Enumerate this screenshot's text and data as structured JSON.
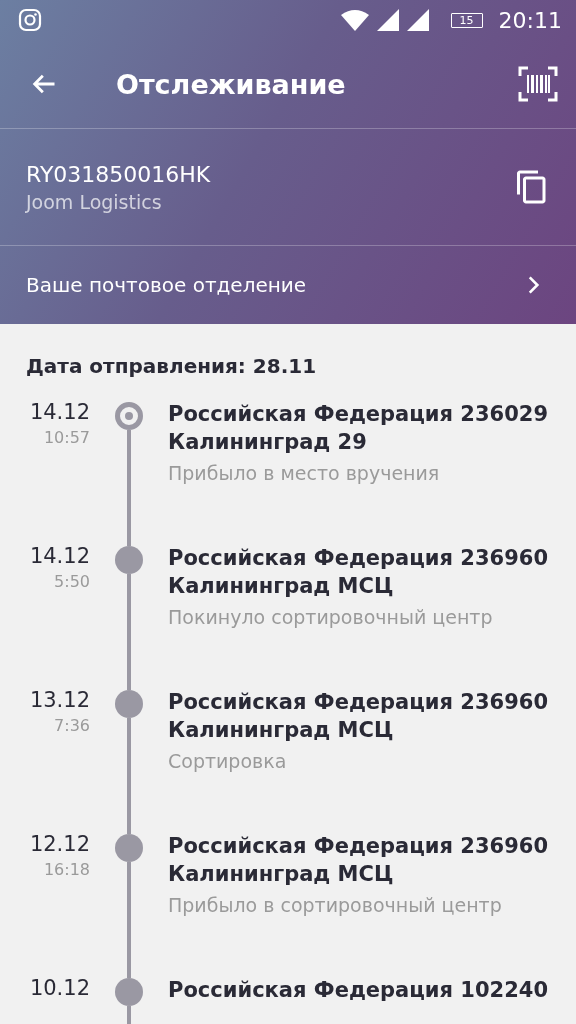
{
  "status_bar": {
    "time": "20:11",
    "battery": "15"
  },
  "toolbar": {
    "title": "Отслеживание"
  },
  "parcel": {
    "tracking_number": "RY031850016HK",
    "carrier": "Joom Logistics"
  },
  "post_office_link": "Ваше почтовое отделение",
  "dispatch_date": "Дата отправления: 28.11",
  "events": [
    {
      "date": "14.12",
      "time": "10:57",
      "place": "Российская Федерация 236029 Калининград 29",
      "status": "Прибыло в место вручения",
      "current": true
    },
    {
      "date": "14.12",
      "time": "5:50",
      "place": "Российская Федерация 236960 Калининград МСЦ",
      "status": "Покинуло сортировочный центр",
      "current": false
    },
    {
      "date": "13.12",
      "time": "7:36",
      "place": "Российская Федерация 236960 Калининград МСЦ",
      "status": "Сортировка",
      "current": false
    },
    {
      "date": "12.12",
      "time": "16:18",
      "place": "Российская Федерация 236960 Калининград МСЦ",
      "status": "Прибыло в сортировочный центр",
      "current": false
    },
    {
      "date": "10.12",
      "place": "Российская Федерация 102240",
      "current": false
    }
  ]
}
